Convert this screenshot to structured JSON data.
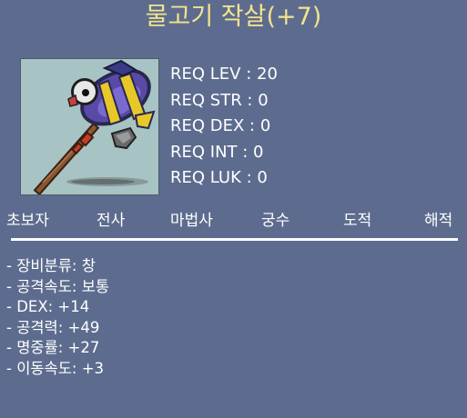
{
  "item": {
    "title": "물고기 작살(+7)",
    "icon": "fish-harpoon-icon",
    "reqs": [
      "REQ LEV : 20",
      "REQ STR : 0",
      "REQ DEX : 0",
      "REQ INT : 0",
      "REQ LUK : 0"
    ],
    "jobs": [
      "초보자",
      "전사",
      "마법사",
      "궁수",
      "도적",
      "해적"
    ],
    "stats": [
      "- 장비분류: 창",
      "- 공격속도: 보통",
      "- DEX: +14",
      "- 공격력: +49",
      "- 명중률: +27",
      "- 이동속도: +3"
    ]
  },
  "colors": {
    "background": "#5d6c8e",
    "title": "#f3e38c",
    "text": "#ffffff",
    "icon_background": "#a7c3c3"
  }
}
